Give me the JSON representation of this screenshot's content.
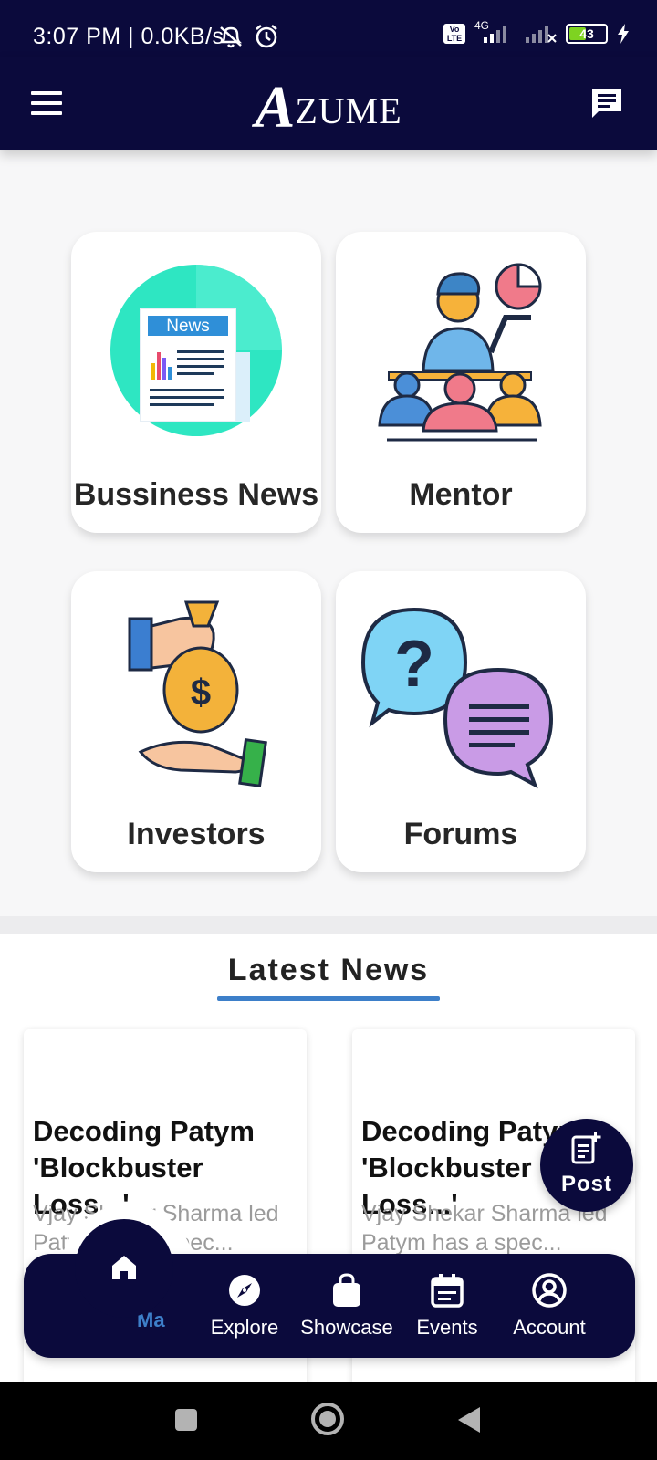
{
  "status_bar": {
    "time": "3:07 PM | 0.0KB/s",
    "battery": "43",
    "volte": "Vo LTE",
    "network": "4G"
  },
  "app_bar": {
    "logo_initial": "A",
    "logo_rest": "ZUME"
  },
  "categories": [
    {
      "label": "Bussiness News",
      "icon": "newspaper-icon",
      "badge": "News"
    },
    {
      "label": "Mentor",
      "icon": "mentor-icon"
    },
    {
      "label": "Investors",
      "icon": "money-bag-icon"
    },
    {
      "label": "Forums",
      "icon": "speech-bubbles-icon"
    }
  ],
  "latest_news": {
    "heading": "Latest News",
    "items": [
      {
        "title": "Decoding Patym\n'Blockbuster Loss...'",
        "excerpt": "Vjay Shekar Sharma led Patym has a spec..."
      },
      {
        "title": "Decoding Patym\n'Blockbuster Loss...'",
        "excerpt": "Vjay Shekar Sharma led Patym has a spec..."
      }
    ]
  },
  "fab": {
    "label": "Post"
  },
  "bottom_nav": {
    "home_peek": "Ma",
    "items": [
      {
        "label": "Explore",
        "icon": "compass-icon"
      },
      {
        "label": "Showcase",
        "icon": "shopping-bag-icon"
      },
      {
        "label": "Events",
        "icon": "calendar-icon"
      },
      {
        "label": "Account",
        "icon": "account-circle-icon"
      }
    ]
  },
  "colors": {
    "primary": "#0b0a3c",
    "accent": "#3d7fc9",
    "teal": "#2ee6c2"
  }
}
